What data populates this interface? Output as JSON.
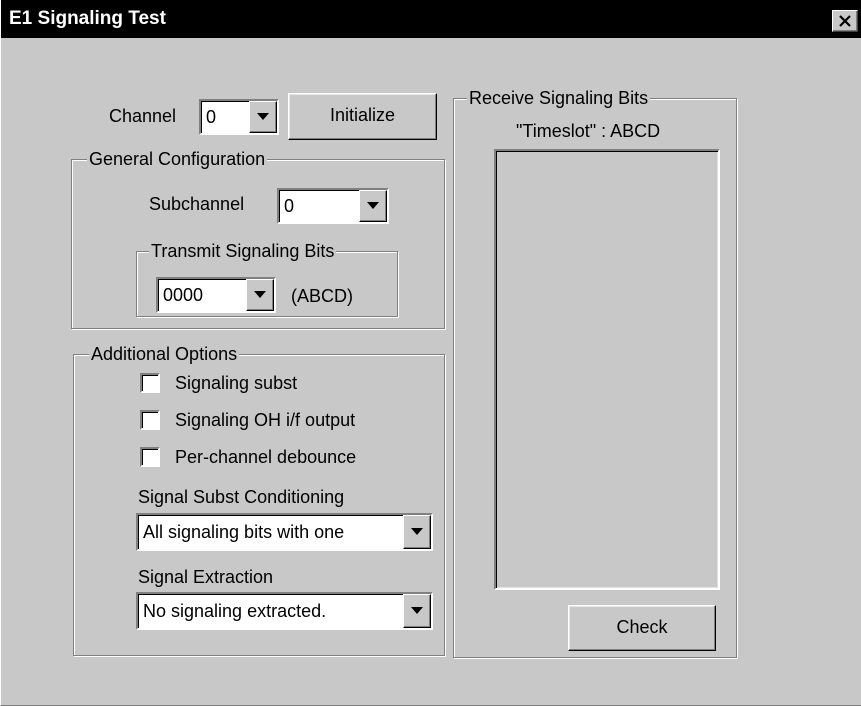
{
  "window": {
    "title": "E1 Signaling Test"
  },
  "channel": {
    "label": "Channel",
    "value": "0"
  },
  "initialize_button": "Initialize",
  "general_configuration": {
    "legend": "General Configuration",
    "subchannel_label": "Subchannel",
    "subchannel_value": "0",
    "transmit_legend": "Transmit Signaling Bits",
    "transmit_value": "0000",
    "transmit_unit": "(ABCD)"
  },
  "additional_options": {
    "legend": "Additional Options",
    "checkboxes": [
      {
        "label": "Signaling subst",
        "checked": false
      },
      {
        "label": "Signaling OH i/f output",
        "checked": false
      },
      {
        "label": "Per-channel debounce",
        "checked": false
      }
    ],
    "subst_conditioning_label": "Signal Subst Conditioning",
    "subst_conditioning_value": "All signaling bits with one",
    "extraction_label": "Signal Extraction",
    "extraction_value": "No signaling extracted."
  },
  "receive": {
    "legend": "Receive Signaling Bits",
    "header": "\"Timeslot\" : ABCD",
    "items": [],
    "check_button": "Check"
  },
  "icons": {
    "close": "close-icon",
    "dropdown": "chevron-down-icon"
  },
  "colors": {
    "titlebar": "#000000",
    "title_text": "#ffffff",
    "dialog_face": "#c8c8c8",
    "field_background": "#ffffff"
  }
}
